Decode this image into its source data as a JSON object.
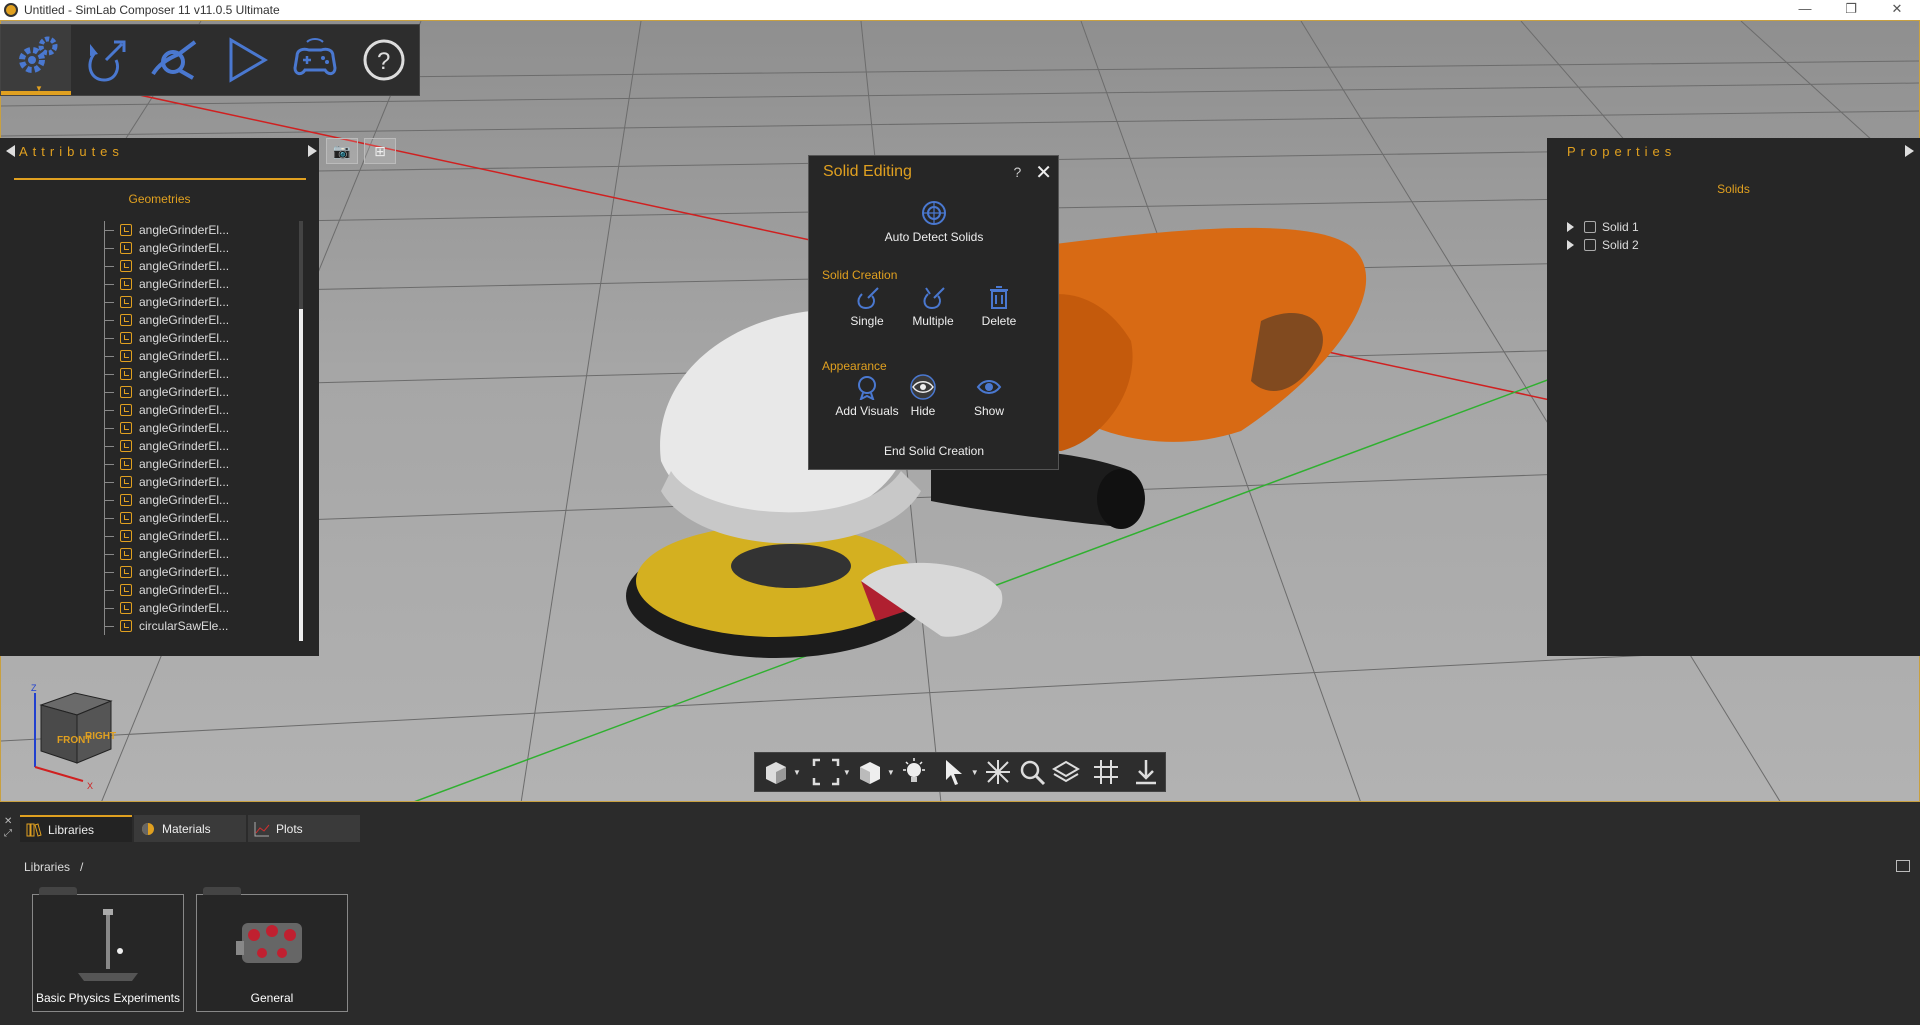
{
  "window": {
    "title": "Untitled - SimLab Composer 11 v11.0.5 Ultimate",
    "controls": [
      "—",
      "❐",
      "✕"
    ]
  },
  "toolbar": {
    "items": [
      "settings",
      "scene",
      "mechanics",
      "play",
      "vr",
      "help"
    ]
  },
  "attributes": {
    "title": "Attributes",
    "section": "Geometries",
    "items": [
      "angleGrinderEl...",
      "angleGrinderEl...",
      "angleGrinderEl...",
      "angleGrinderEl...",
      "angleGrinderEl...",
      "angleGrinderEl...",
      "angleGrinderEl...",
      "angleGrinderEl...",
      "angleGrinderEl...",
      "angleGrinderEl...",
      "angleGrinderEl...",
      "angleGrinderEl...",
      "angleGrinderEl...",
      "angleGrinderEl...",
      "angleGrinderEl...",
      "angleGrinderEl...",
      "angleGrinderEl...",
      "angleGrinderEl...",
      "angleGrinderEl...",
      "angleGrinderEl...",
      "angleGrinderEl...",
      "angleGrinderEl...",
      "circularSawEle..."
    ]
  },
  "properties": {
    "title": "Properties",
    "section": "Solids",
    "items": [
      "Solid 1",
      "Solid 2"
    ]
  },
  "solid_editing": {
    "title": "Solid Editing",
    "help": "?",
    "close": "✕",
    "auto_detect": "Auto Detect Solids",
    "creation_label": "Solid Creation",
    "single": "Single",
    "multiple": "Multiple",
    "delete": "Delete",
    "appearance_label": "Appearance",
    "add_visuals": "Add Visuals",
    "hide": "Hide",
    "show": "Show",
    "end": "End Solid Creation"
  },
  "viewcube": {
    "front": "FRONT",
    "right": "RIGHT",
    "z": "Z",
    "x": "X"
  },
  "bottom": {
    "tabs": [
      "Libraries",
      "Materials",
      "Plots"
    ],
    "breadcrumb": [
      "Libraries",
      "/"
    ],
    "libraries": [
      "Basic Physics Experiments",
      "General"
    ]
  },
  "colors": {
    "accent": "#e0a020",
    "panel": "#262626",
    "icon_blue": "#4a78d0"
  }
}
